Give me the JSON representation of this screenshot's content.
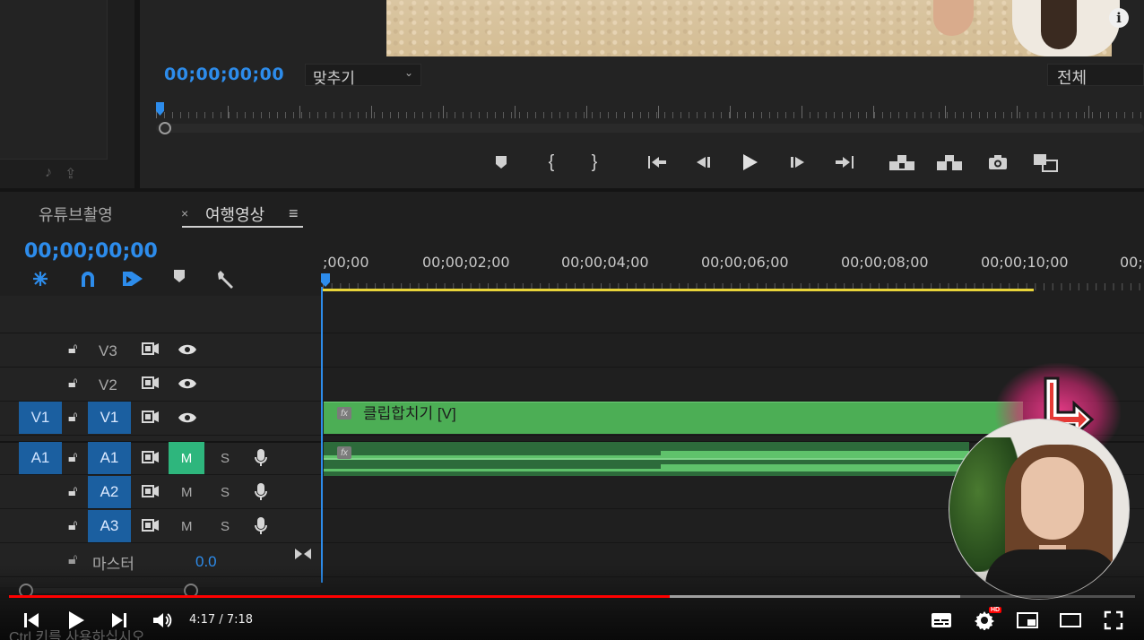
{
  "program_monitor": {
    "timecode": "00;00;00;00",
    "fit_dropdown": "맞추기",
    "resolution_dropdown": "전체",
    "transport_icons": [
      "add-marker-icon",
      "mark-in-icon",
      "mark-out-icon",
      "go-to-in-icon",
      "step-back-icon",
      "play-icon",
      "step-forward-icon",
      "go-to-out-icon",
      "lift-icon",
      "extract-icon",
      "export-frame-icon",
      "compare-view-icon"
    ]
  },
  "timeline": {
    "tabs": [
      {
        "label": "유튜브촬영"
      },
      {
        "label": "여행영상",
        "close": "×",
        "menu": "≡"
      }
    ],
    "timecode": "00;00;00;00",
    "tools": [
      "nest-icon",
      "snap-icon",
      "linked-selection-icon",
      "add-marker-icon",
      "settings-wrench-icon"
    ],
    "ruler_labels": [
      ";00;00",
      "00;00;02;00",
      "00;00;04;00",
      "00;00;06;00",
      "00;00;08;00",
      "00;00;10;00",
      "00;0"
    ],
    "video_tracks": [
      {
        "name": "V3",
        "target": ""
      },
      {
        "name": "V2",
        "target": ""
      },
      {
        "name": "V1",
        "target": "V1"
      }
    ],
    "audio_tracks": [
      {
        "name": "A1",
        "target": "A1",
        "m": "M",
        "s": "S",
        "muted": true
      },
      {
        "name": "A2",
        "target": "",
        "m": "M",
        "s": "S",
        "muted": false
      },
      {
        "name": "A3",
        "target": "",
        "m": "M",
        "s": "S",
        "muted": false
      }
    ],
    "master_label": "마스터",
    "master_value": "0.0",
    "video_clip": {
      "label": "클립합치기 [V]",
      "fx": "fx"
    },
    "audio_clip": {
      "fx": "fx"
    }
  },
  "player": {
    "current_time": "4:17",
    "duration": "7:18",
    "time_display": "4:17 / 7:18",
    "played_fraction": 0.587,
    "buffered_fraction": 0.845,
    "caption_hint": "Ctrl 키를 사용하십시오.",
    "hd_badge": "HD",
    "info_icon": "i"
  }
}
